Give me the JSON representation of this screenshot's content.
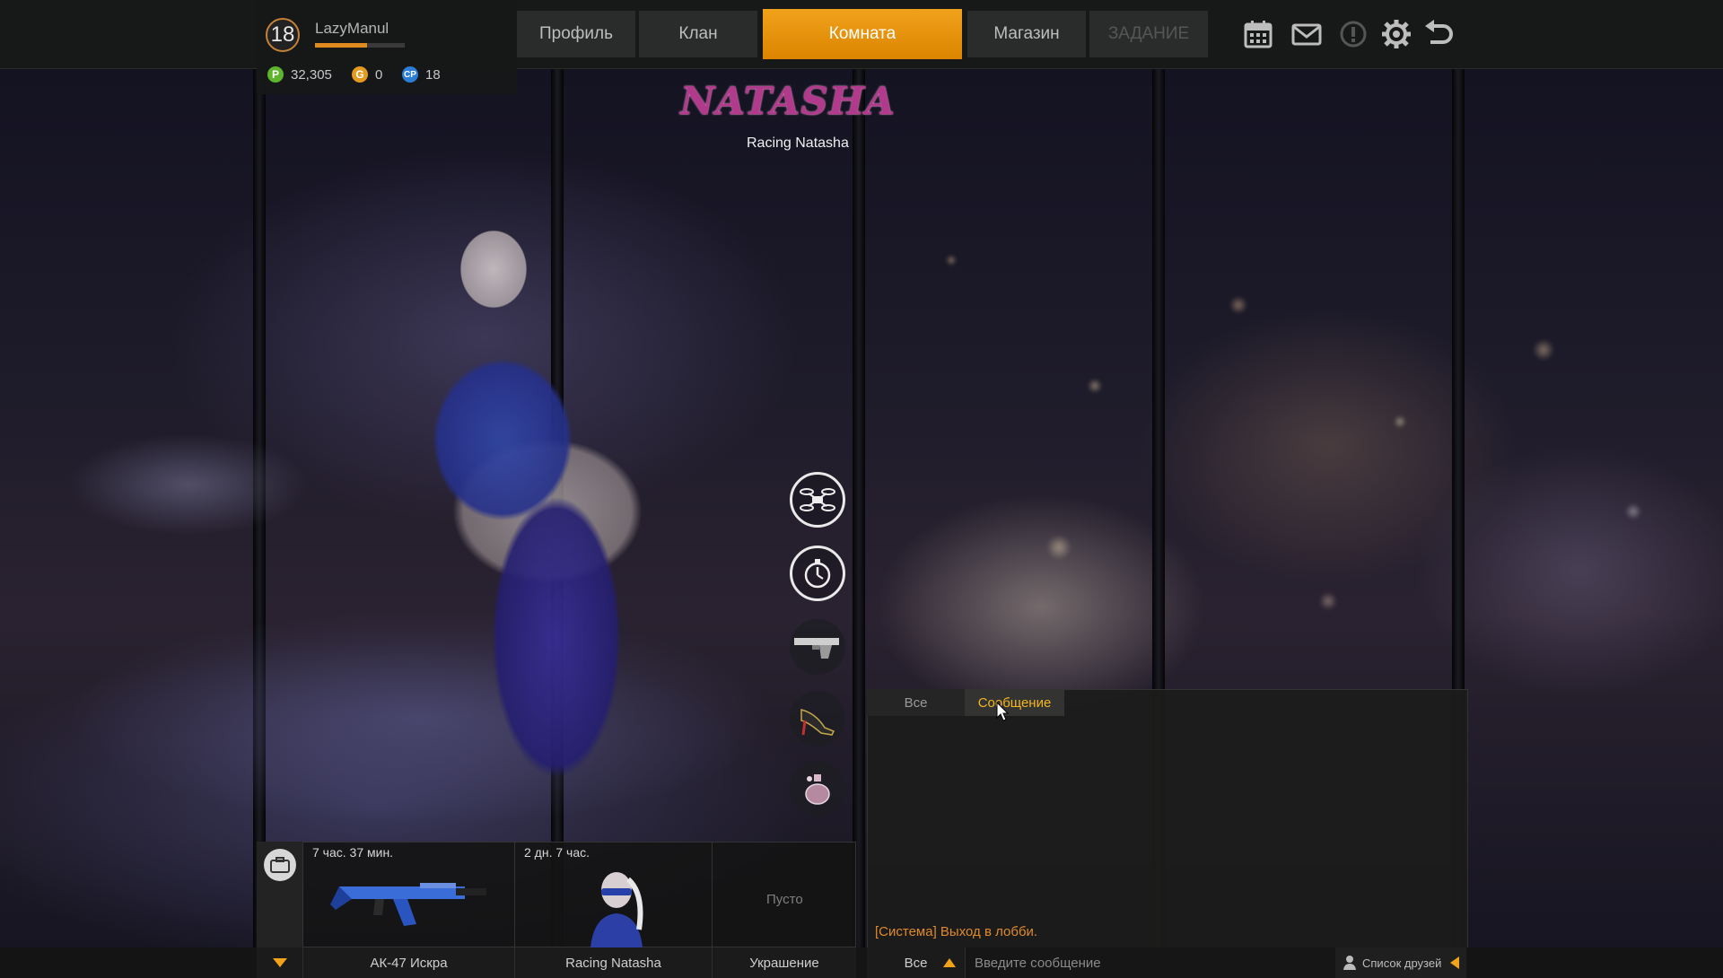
{
  "player": {
    "level": "18",
    "name": "LazyManul",
    "xp_progress": 0.58,
    "currencies": [
      {
        "icon": "P",
        "value": "32,305",
        "color": "#5cb52b"
      },
      {
        "icon": "G",
        "value": "0",
        "color": "#e39a1e"
      },
      {
        "icon": "CP",
        "value": "18",
        "color": "#2b7ed6"
      }
    ]
  },
  "nav": {
    "profile": "Профиль",
    "clan": "Клан",
    "room": "Комната",
    "shop": "Магазин",
    "task": "ЗАДАНИЕ"
  },
  "top_icons": [
    "calendar-icon",
    "mail-icon",
    "alert-icon",
    "settings-icon",
    "back-icon"
  ],
  "character": {
    "logo": "NATASHA",
    "subtitle": "Racing Natasha"
  },
  "equipment_buttons": [
    "drone-icon",
    "stopwatch-icon",
    "pistol-icon",
    "heel-shoe-icon",
    "perfume-icon"
  ],
  "loadout": {
    "slots": [
      {
        "timer": "7 час. 37 мин.",
        "label": "АК-47 Искра"
      },
      {
        "timer": "2 дн. 7 час.",
        "label": "Racing Natasha"
      },
      {
        "empty": "Пусто",
        "label": "Украшение"
      }
    ]
  },
  "chat": {
    "tabs": [
      "Все",
      "Сообщение"
    ],
    "active_tab": "Сообщение",
    "messages": [
      {
        "text": "[Система] Выход в лобби.",
        "color": "#e08a2a"
      }
    ],
    "filter": "Все",
    "input_placeholder": "Введите сообщение",
    "friends_label": "Список друзей"
  },
  "colors": {
    "accent": "#f0a21b",
    "top_bar": "#171818",
    "system_message": "#e08a2a"
  }
}
